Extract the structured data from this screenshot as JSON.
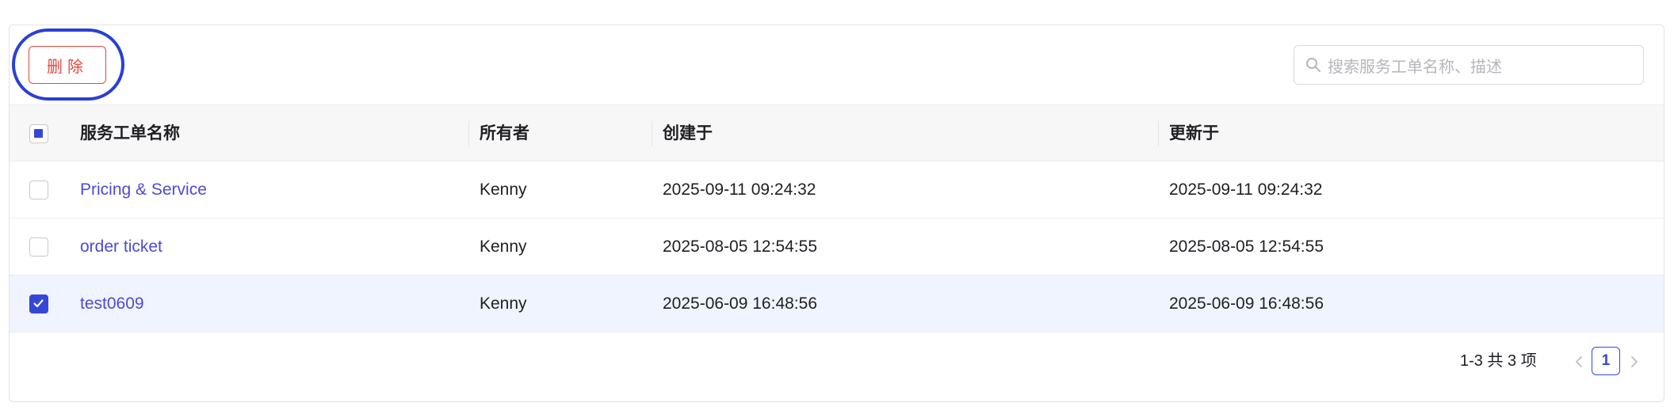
{
  "toolbar": {
    "delete_label": "删除",
    "search_placeholder": "搜索服务工单名称、描述"
  },
  "table": {
    "columns": [
      "服务工单名称",
      "所有者",
      "创建于",
      "更新于"
    ],
    "header_checkbox_state": "indeterminate",
    "rows": [
      {
        "name": "Pricing & Service",
        "owner": "Kenny",
        "created": "2025-09-11 09:24:32",
        "updated": "2025-09-11 09:24:32",
        "selected": false
      },
      {
        "name": "order ticket",
        "owner": "Kenny",
        "created": "2025-08-05 12:54:55",
        "updated": "2025-08-05 12:54:55",
        "selected": false
      },
      {
        "name": "test0609",
        "owner": "Kenny",
        "created": "2025-06-09 16:48:56",
        "updated": "2025-06-09 16:48:56",
        "selected": true
      }
    ]
  },
  "pagination": {
    "summary": "1-3 共 3 项",
    "current_page": "1"
  },
  "colors": {
    "accent": "#3547d6",
    "link": "#4c4bd4",
    "danger": "#e5483f",
    "highlight_ring": "#2a3fd6",
    "selected_row": "#f0f4fe"
  },
  "icons": {
    "search": "search-icon",
    "check": "check-icon",
    "prev": "chevron-left-icon",
    "next": "chevron-right-icon"
  }
}
